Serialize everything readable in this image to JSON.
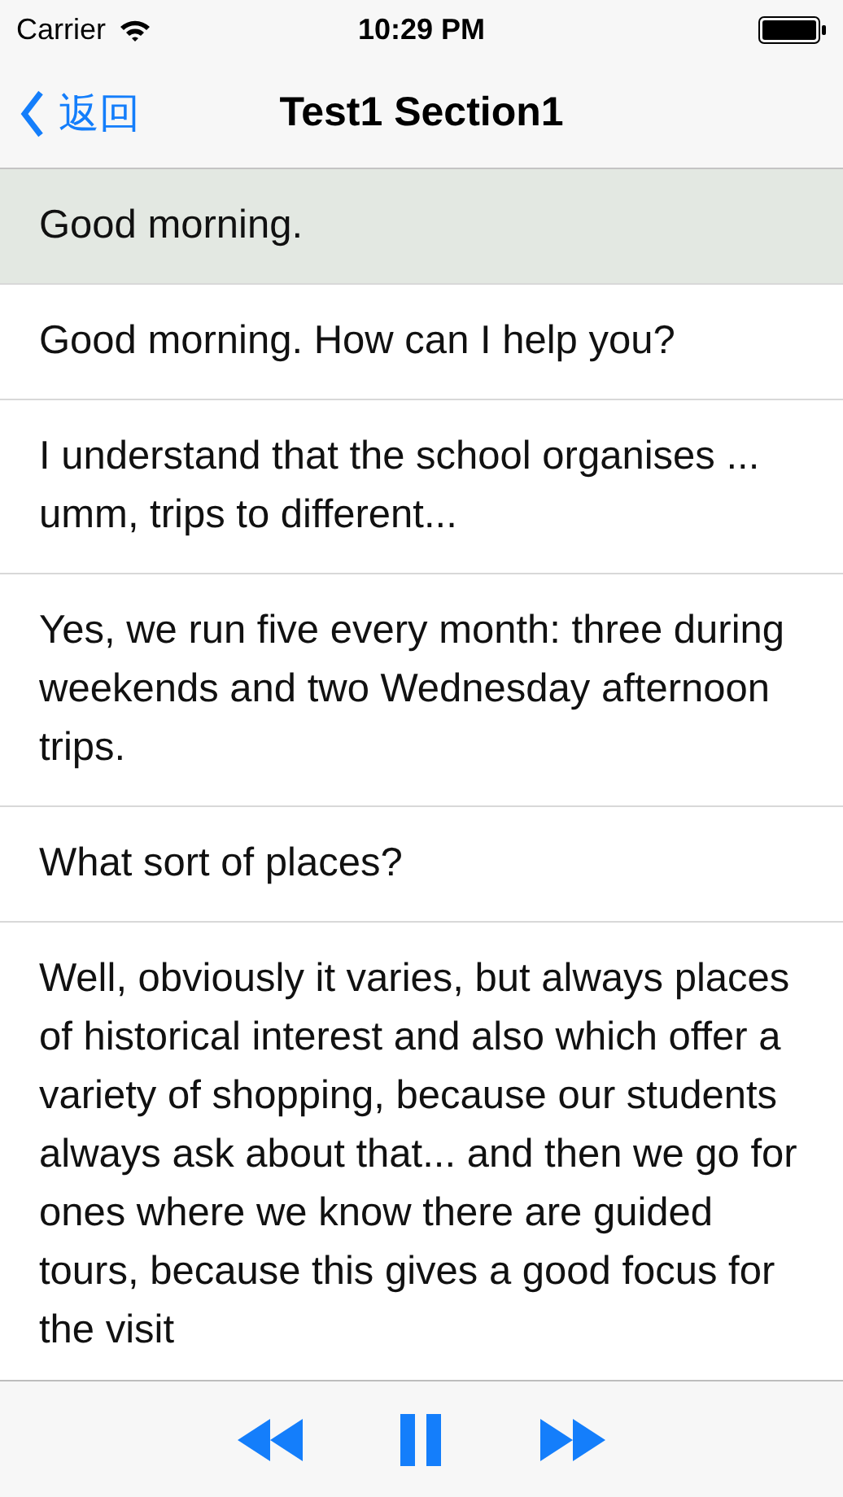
{
  "status_bar": {
    "carrier": "Carrier",
    "time": "10:29 PM"
  },
  "nav_bar": {
    "back": "返回",
    "title": "Test1 Section1"
  },
  "lines": [
    {
      "text": "Good morning.",
      "selected": true
    },
    {
      "text": "Good morning. How can I help you?",
      "selected": false
    },
    {
      "text": "I understand that the school organises ... umm, trips to different...",
      "selected": false
    },
    {
      "text": "Yes, we run five every month: three during weekends and two Wednesday afternoon trips.",
      "selected": false
    },
    {
      "text": "What sort of places?",
      "selected": false
    },
    {
      "text": "Well, obviously it varies, but always places of historical interest and also which offer a variety of shopping, because our students always ask about that... and then we go for ones where we know there are guided tours, because this gives a good focus for the visit",
      "selected": false
    }
  ],
  "player": {
    "playing": true
  }
}
